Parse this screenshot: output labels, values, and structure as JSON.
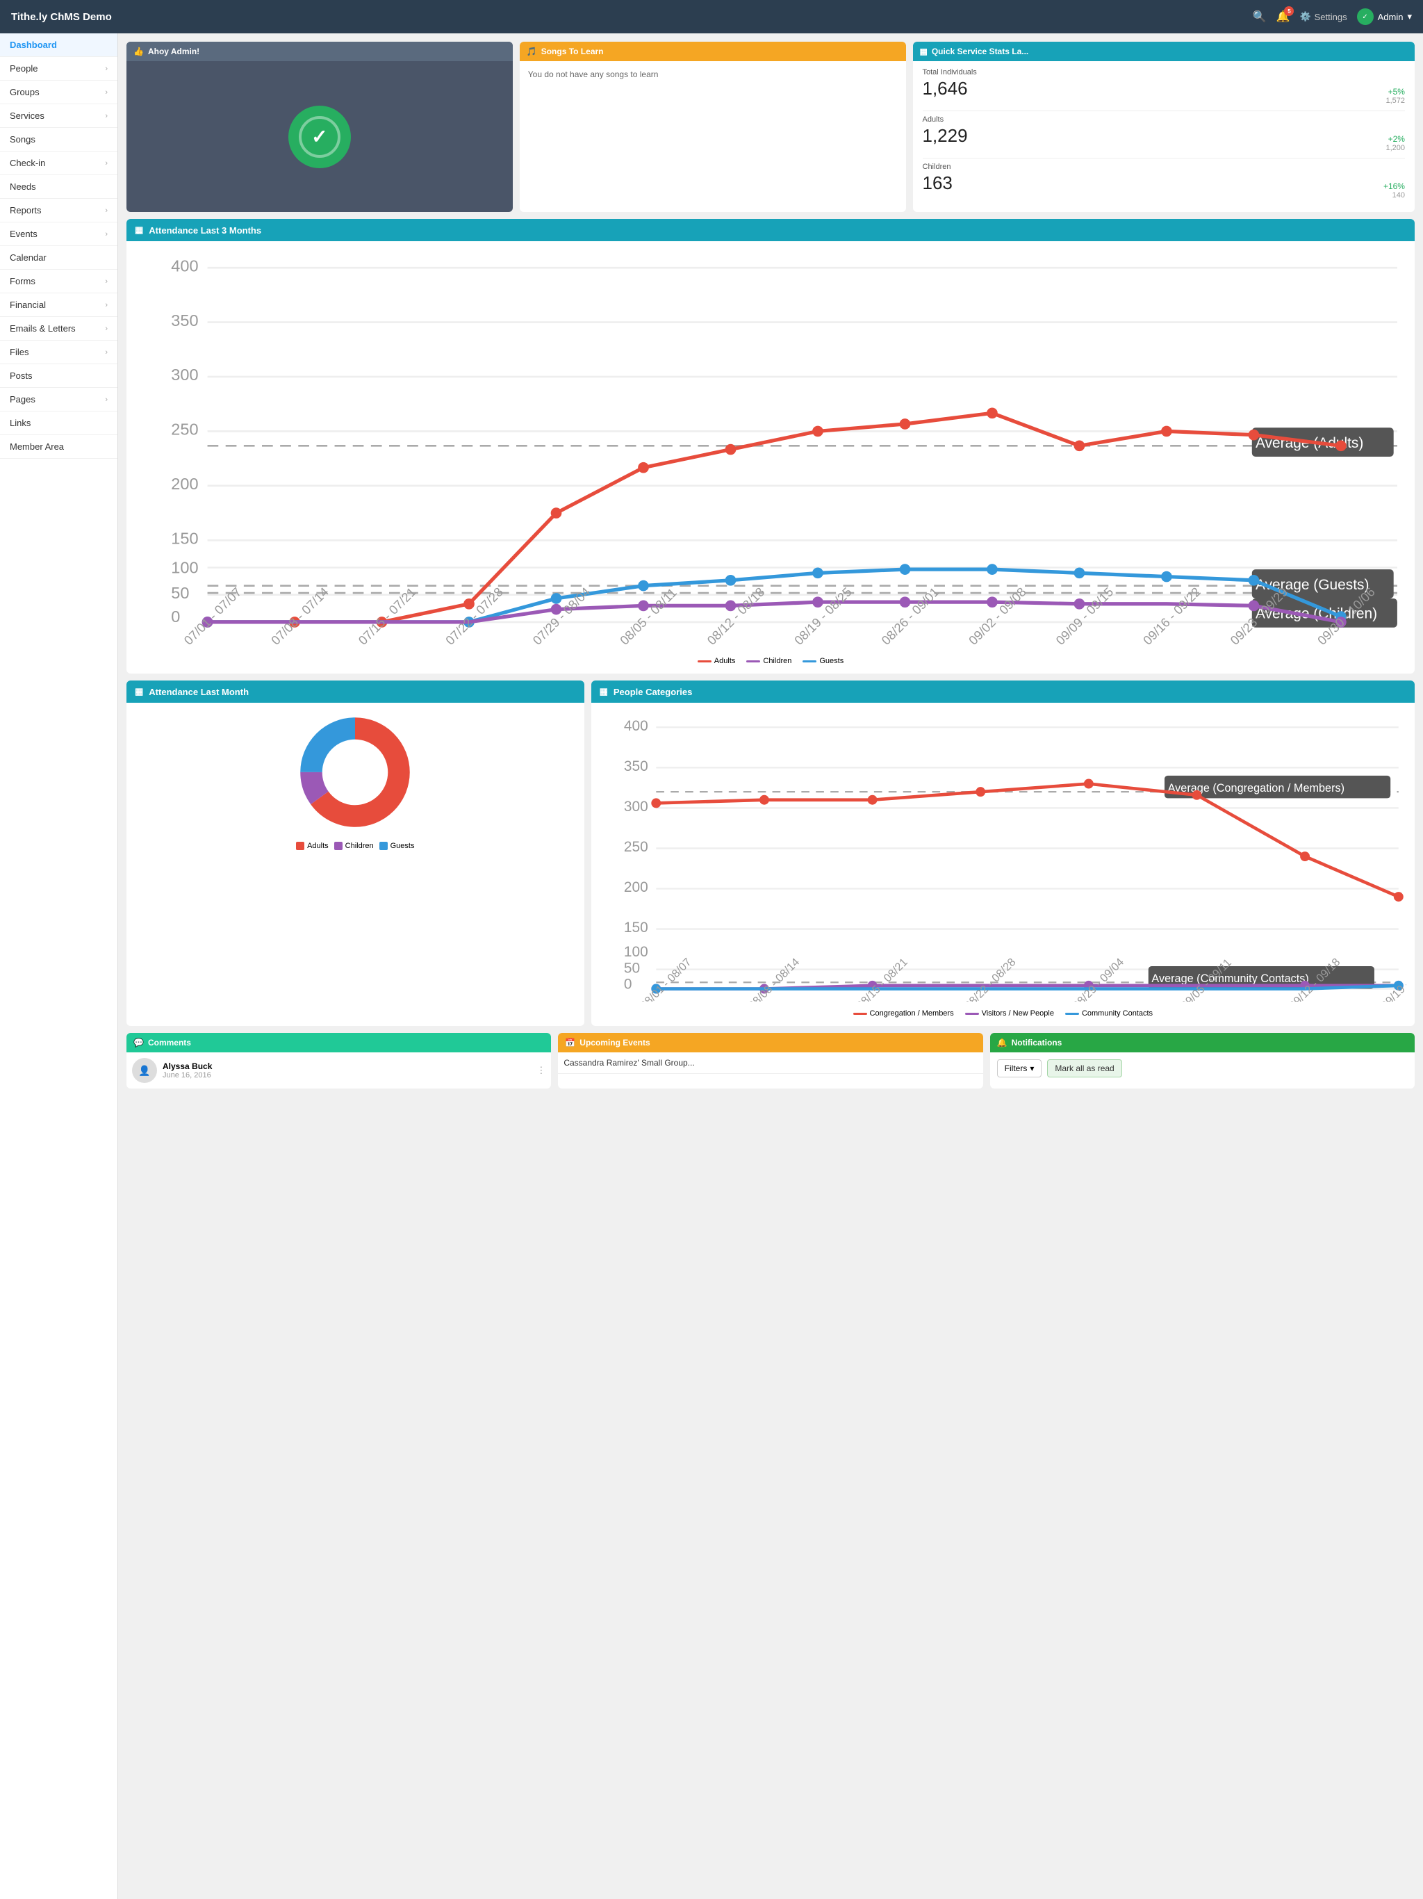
{
  "header": {
    "logo": "Tithe.ly ChMS Demo",
    "notif_count": "5",
    "settings_label": "Settings",
    "admin_label": "Admin"
  },
  "sidebar": {
    "items": [
      {
        "label": "Dashboard",
        "has_arrow": false,
        "active": true
      },
      {
        "label": "People",
        "has_arrow": true,
        "active": false
      },
      {
        "label": "Groups",
        "has_arrow": true,
        "active": false
      },
      {
        "label": "Services",
        "has_arrow": true,
        "active": false
      },
      {
        "label": "Songs",
        "has_arrow": false,
        "active": false
      },
      {
        "label": "Check-in",
        "has_arrow": true,
        "active": false
      },
      {
        "label": "Needs",
        "has_arrow": false,
        "active": false
      },
      {
        "label": "Reports",
        "has_arrow": true,
        "active": false
      },
      {
        "label": "Events",
        "has_arrow": true,
        "active": false
      },
      {
        "label": "Calendar",
        "has_arrow": false,
        "active": false
      },
      {
        "label": "Forms",
        "has_arrow": true,
        "active": false
      },
      {
        "label": "Financial",
        "has_arrow": true,
        "active": false
      },
      {
        "label": "Emails & Letters",
        "has_arrow": true,
        "active": false
      },
      {
        "label": "Files",
        "has_arrow": true,
        "active": false
      },
      {
        "label": "Posts",
        "has_arrow": false,
        "active": false
      },
      {
        "label": "Pages",
        "has_arrow": true,
        "active": false
      },
      {
        "label": "Links",
        "has_arrow": false,
        "active": false
      },
      {
        "label": "Member Area",
        "has_arrow": false,
        "active": false
      }
    ]
  },
  "welcome": {
    "header": "Ahoy Admin!",
    "icon": "👍"
  },
  "songs": {
    "header": "Songs To Learn",
    "icon": "🎵",
    "body": "You do not have any songs to learn"
  },
  "stats": {
    "header": "Quick Service Stats La...",
    "total_label": "Total Individuals",
    "total_value": "1,646",
    "total_change": "+5%",
    "total_prev": "1,572",
    "adults_label": "Adults",
    "adults_value": "1,229",
    "adults_change": "+2%",
    "adults_prev": "1,200",
    "children_label": "Children",
    "children_value": "163",
    "children_change": "+16%",
    "children_prev": "140"
  },
  "attendance3m": {
    "header": "Attendance Last 3 Months",
    "legend": {
      "adults": "Adults",
      "children": "Children",
      "guests": "Guests"
    },
    "avg_adults_label": "Average (Adults)",
    "x_labels": [
      "07/01 - 07/07",
      "07/08 - 07/14",
      "07/15 - 07/21",
      "07/22 - 07/28",
      "07/29 - 08/04",
      "08/05 - 08/11",
      "08/12 - 08/18",
      "08/19 - 08/25",
      "08/26 - 09/01",
      "09/02 - 09/08",
      "09/09 - 09/15",
      "09/16 - 09/22",
      "09/23 - 09/29",
      "09/30 - 10/06"
    ]
  },
  "attendanceMonth": {
    "header": "Attendance Last Month",
    "legend": {
      "adults": "Adults",
      "children": "Children",
      "guests": "Guests"
    }
  },
  "peopleCategories": {
    "header": "People Categories",
    "legend": {
      "congregation": "Congregation / Members",
      "visitors": "Visitors / New People",
      "community": "Community Contacts"
    },
    "avg_label": "Average (Congregation / Members)",
    "avg_community_label": "Average (Community Contacts)"
  },
  "comments": {
    "header": "Comments",
    "icon": "💬",
    "item": {
      "name": "Alyssa Buck",
      "date": "June 16, 2016"
    }
  },
  "upcoming_events": {
    "header": "Upcoming Events",
    "icon": "📅",
    "item": "Cassandra Ramirez' Small Group..."
  },
  "notifications": {
    "header": "Notifications",
    "icon": "🔔",
    "filters_label": "Filters",
    "mark_all_label": "Mark all as read"
  },
  "colors": {
    "teal": "#17a2b8",
    "green": "#27ae60",
    "orange": "#f5a623",
    "red": "#e74c3c",
    "purple": "#9b59b6",
    "blue": "#3498db",
    "sidebar_bg": "#ffffff",
    "header_bg": "#2c3e50"
  }
}
